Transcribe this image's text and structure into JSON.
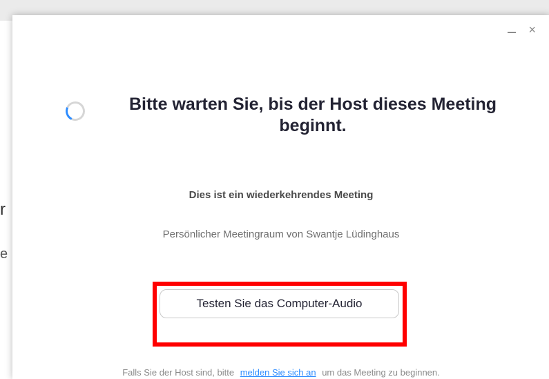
{
  "background": {
    "fragment_1": "r",
    "fragment_2": "e"
  },
  "window": {
    "minimize_label": "–",
    "close_label": "×"
  },
  "dialog": {
    "title": "Bitte warten Sie, bis der Host dieses Meeting beginnt.",
    "subtitle": "Dies ist ein wiederkehrendes Meeting",
    "room_text": "Persönlicher Meetingraum von Swantje Lüdinghaus",
    "audio_button_label": "Testen Sie das Computer-Audio",
    "footer": {
      "before_link": "Falls Sie der Host sind, bitte",
      "link": "melden Sie sich an",
      "after_link": "um das Meeting zu beginnen."
    }
  },
  "icons": {
    "loading": "loading-spinner-icon",
    "minimize": "minimize-icon",
    "close": "close-icon"
  },
  "colors": {
    "highlight": "#ff0000",
    "spinner_accent": "#2d8cff",
    "link": "#2d8cff",
    "title_text": "#232333",
    "muted_text": "#8b8b8b"
  }
}
